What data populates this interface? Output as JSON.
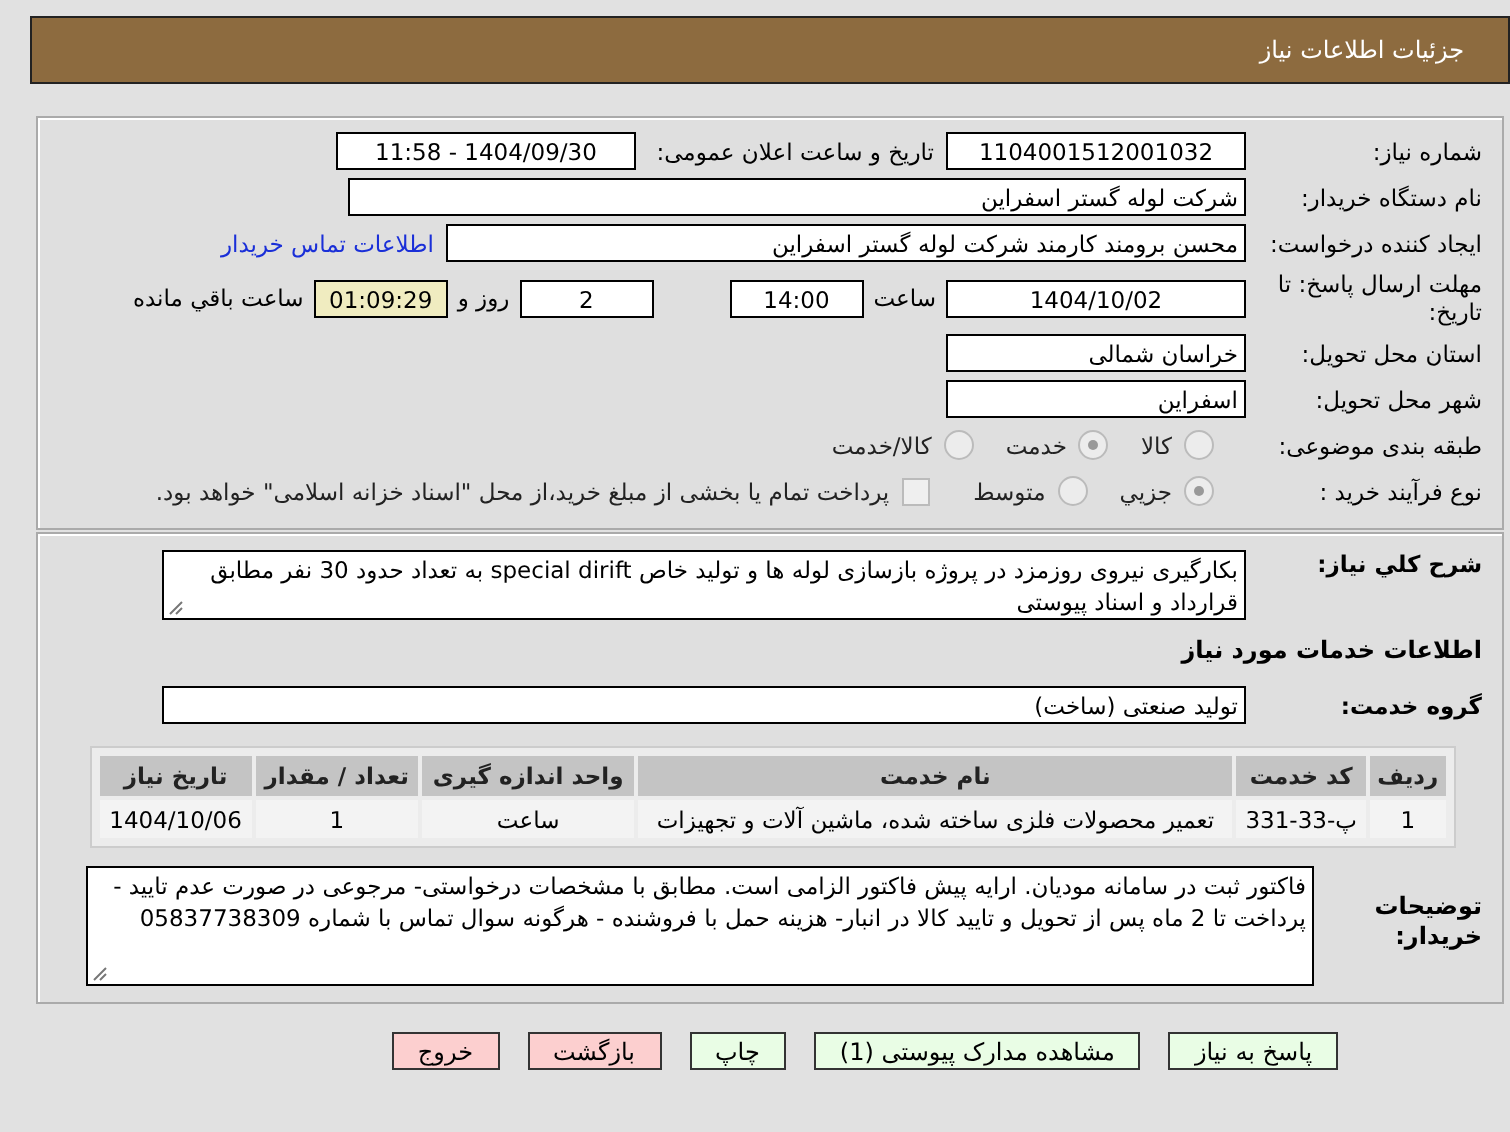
{
  "header": {
    "title": "جزئیات اطلاعات نیاز"
  },
  "need_number": {
    "label": "شماره نیاز:",
    "value": "1104001512001032"
  },
  "announce": {
    "label": "تاریخ و ساعت اعلان عمومی:",
    "value": "1404/09/30 - 11:58"
  },
  "buyer": {
    "label": "نام دستگاه خریدار:",
    "value": "شرکت لوله گستر اسفراین"
  },
  "creator": {
    "label": "ایجاد کننده درخواست:",
    "value": "محسن برومند کارمند شرکت لوله گستر اسفراین",
    "link": "اطلاعات تماس خریدار"
  },
  "deadline": {
    "label": "مهلت ارسال پاسخ: تا تاریخ:",
    "date": "1404/10/02",
    "time_label": "ساعت",
    "time": "14:00",
    "days": "2",
    "days_label": "روز و",
    "remaining": "01:09:29",
    "remaining_label": "ساعت باقي مانده"
  },
  "province": {
    "label": "استان محل تحویل:",
    "value": "خراسان شمالی"
  },
  "city": {
    "label": "شهر محل تحویل:",
    "value": "اسفراین"
  },
  "category": {
    "label": "طبقه بندی موضوعی:",
    "options": [
      {
        "label": "كالا",
        "selected": false
      },
      {
        "label": "خدمت",
        "selected": true
      },
      {
        "label": "كالا/خدمت",
        "selected": false
      }
    ]
  },
  "process": {
    "label": "نوع فرآیند خرید :",
    "options": [
      {
        "label": "جزيي",
        "selected": true
      },
      {
        "label": "متوسط",
        "selected": false
      }
    ],
    "payment": {
      "label": "پرداخت تمام یا بخشی از مبلغ خرید،از محل \"اسناد خزانه اسلامی\" خواهد بود.",
      "checked": false
    }
  },
  "description": {
    "label": "شرح كلي نياز:",
    "value": "بکارگیری نیروی روزمزد در پروژه بازسازی لوله ها و تولید خاص special dirift به تعداد حدود 30 نفر مطابق قرارداد و اسناد پیوستی"
  },
  "services_heading": "اطلاعات خدمات مورد نياز",
  "service_group": {
    "label": "گروه خدمت:",
    "value": "تولید صنعتی (ساخت)"
  },
  "table": {
    "columns": [
      "ردیف",
      "کد خدمت",
      "نام خدمت",
      "واحد اندازه گیری",
      "تعداد / مقدار",
      "تاریخ نیاز"
    ],
    "rows": [
      [
        "1",
        "پ-33-331",
        "تعمیر محصولات فلزی ساخته شده، ماشین آلات و تجهیزات",
        "ساعت",
        "1",
        "1404/10/06"
      ]
    ]
  },
  "buyer_notes": {
    "label": "توضیحات خریدار:",
    "value": "فاکتور ثبت در سامانه مودیان. ارایه پیش فاکتور الزامی است. مطابق با مشخصات درخواستی- مرجوعی در صورت عدم تایید - پرداخت تا 2 ماه پس از تحویل و تایید کالا در انبار- هزینه حمل با فروشنده - هرگونه سوال تماس با شماره 05837738309"
  },
  "buttons": [
    {
      "label": "پاسخ به نیاز",
      "kind": "primary"
    },
    {
      "label": "مشاهده مدارک پیوستی (1)",
      "kind": "primary"
    },
    {
      "label": "چاپ",
      "kind": "primary"
    },
    {
      "label": "بازگشت",
      "kind": "danger"
    },
    {
      "label": "خروج",
      "kind": "danger"
    }
  ]
}
